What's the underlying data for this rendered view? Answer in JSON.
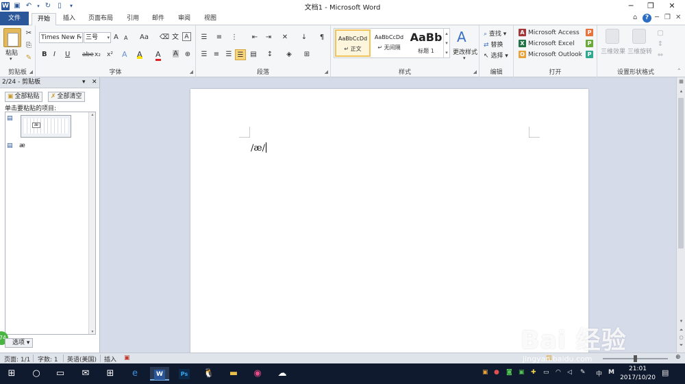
{
  "titlebar": {
    "title": "文档1 - Microsoft Word",
    "qat_icons": [
      "word-logo",
      "save-icon",
      "undo-icon",
      "redo-icon",
      "new-doc-icon",
      "customize-icon"
    ],
    "word_logo": "W"
  },
  "tabs": {
    "items": [
      "文件",
      "开始",
      "插入",
      "页面布局",
      "引用",
      "邮件",
      "审阅",
      "视图"
    ],
    "active": "开始"
  },
  "ribbon": {
    "clipboard": {
      "label": "剪贴板",
      "paste": "粘贴",
      "icons": [
        "cut-icon",
        "copy-icon",
        "format-painter-icon"
      ]
    },
    "font": {
      "label": "字体",
      "font_name": "Times New F",
      "font_size": "三号",
      "grow": "A",
      "shrink": "A",
      "change_case": "Aa",
      "bold": "B",
      "italic": "I",
      "underline": "U",
      "strike": "abe",
      "subscript": "x₂",
      "superscript": "x²",
      "highlight": "A",
      "font_color": "A",
      "char_shading": "A"
    },
    "paragraph": {
      "label": "段落"
    },
    "styles": {
      "label": "样式",
      "items": [
        {
          "preview": "AaBbCcDd",
          "name": "↵ 正文"
        },
        {
          "preview": "AaBbCcDd",
          "name": "↵ 无间隔"
        },
        {
          "preview": "AaBb",
          "name": "标题 1"
        }
      ],
      "change_styles": "更改样式"
    },
    "editing": {
      "label": "编辑",
      "find": "查找",
      "replace": "替换",
      "select": "选择"
    },
    "open": {
      "label": "打开",
      "apps": [
        {
          "name": "Microsoft Access",
          "letter": "A",
          "color": "#a4373a"
        },
        {
          "name": "Microsoft Excel",
          "letter": "X",
          "color": "#217346"
        },
        {
          "name": "Microsoft Outlook",
          "letter": "O",
          "color": "#e8a33d"
        }
      ],
      "tags": [
        {
          "letter": "P",
          "color": "#e8743b"
        },
        {
          "letter": "P",
          "color": "#6aaa3a"
        },
        {
          "letter": "P",
          "color": "#2fa98f"
        }
      ]
    },
    "shape_format": {
      "label": "设置形状格式",
      "effects_3d": "三维效果",
      "rotation_3d": "三维旋转"
    }
  },
  "clipboard_pane": {
    "title": "2/24 - 剪贴板",
    "paste_all": "全部粘贴",
    "clear_all": "全部清空",
    "hint": "单击要粘贴的项目:",
    "item_text": "æ",
    "thumb_key": "æ",
    "options": "选项",
    "bubble": "74"
  },
  "document": {
    "text": "/æ/"
  },
  "statusbar": {
    "page": "页面: 1/1",
    "words": "字数: 1",
    "language": "英语(美国)",
    "mode": "插入"
  },
  "taskbar": {
    "time": "21:01",
    "date": "2017/10/20",
    "ime": "中",
    "ime2": "M"
  },
  "watermark": {
    "logo": "Bai 经验",
    "url": "jingyan.baidu.com"
  },
  "colors": {
    "accent": "#2b579a",
    "taskbar": "#0f1a2e",
    "ribbon": "#f5f6f7"
  }
}
